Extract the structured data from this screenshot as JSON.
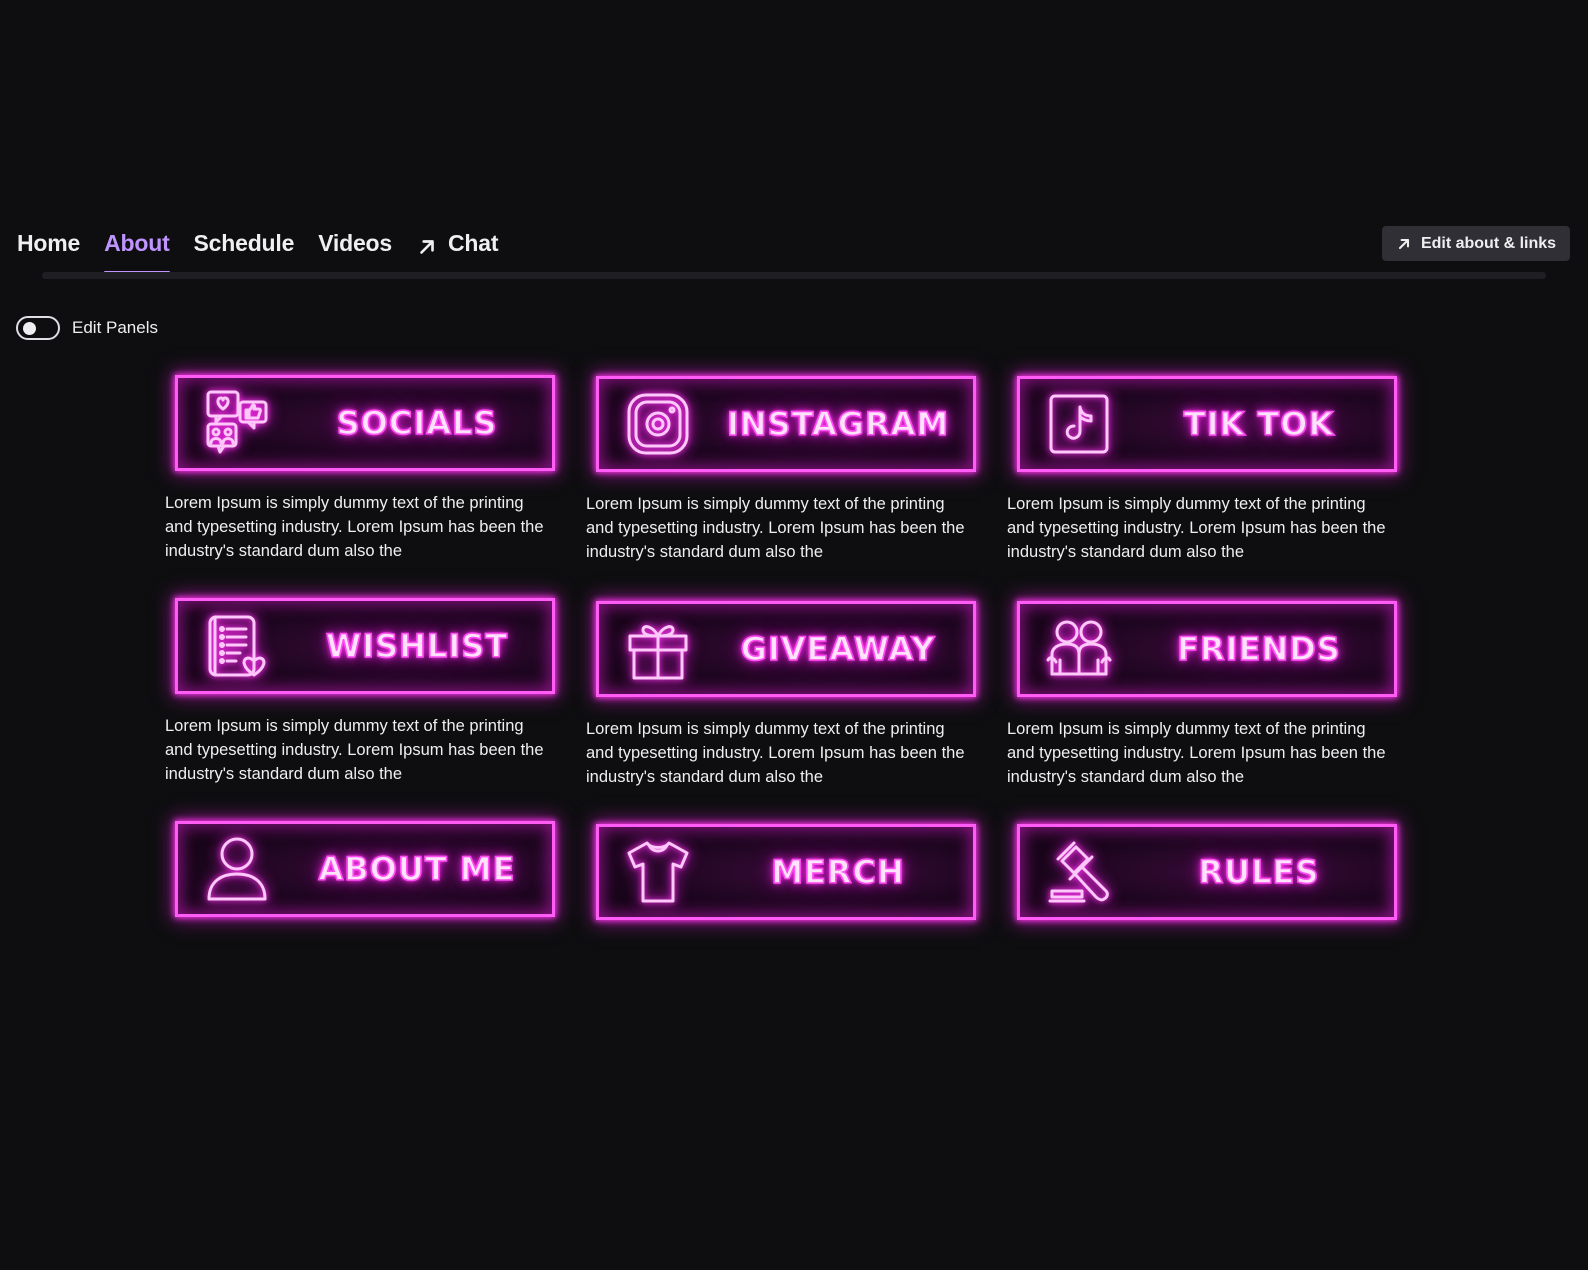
{
  "nav": {
    "tabs": [
      {
        "label": "Home"
      },
      {
        "label": "About"
      },
      {
        "label": "Schedule"
      },
      {
        "label": "Videos"
      },
      {
        "label": "Chat"
      }
    ],
    "active_tab": "About",
    "edit_links_label": "Edit about & links"
  },
  "edit_panels": {
    "label": "Edit Panels",
    "enabled": false
  },
  "panels": [
    {
      "title": "SOCIALS",
      "icon": "social-media-icon",
      "description": "Lorem Ipsum is simply dummy text of the printing and typesetting industry. Lorem Ipsum has been the industry's standard dum also the"
    },
    {
      "title": "INSTAGRAM",
      "icon": "instagram-icon",
      "description": "Lorem Ipsum is simply dummy text of the printing and typesetting industry. Lorem Ipsum has been the industry's standard dum also the"
    },
    {
      "title": "TIK TOK",
      "icon": "tiktok-icon",
      "description": "Lorem Ipsum is simply dummy text of the printing and typesetting industry. Lorem Ipsum has been the industry's standard dum also the"
    },
    {
      "title": "WISHLIST",
      "icon": "wishlist-icon",
      "description": "Lorem Ipsum is simply dummy text of the printing and typesetting industry. Lorem Ipsum has been the industry's standard dum also the"
    },
    {
      "title": "GIVEAWAY",
      "icon": "gift-icon",
      "description": "Lorem Ipsum is simply dummy text of the printing and typesetting industry. Lorem Ipsum has been the industry's standard dum also the"
    },
    {
      "title": "FRIENDS",
      "icon": "friends-icon",
      "description": "Lorem Ipsum is simply dummy text of the printing and typesetting industry. Lorem Ipsum has been the industry's standard dum also the"
    },
    {
      "title": "ABOUT ME",
      "icon": "user-icon",
      "description": ""
    },
    {
      "title": "MERCH",
      "icon": "tshirt-icon",
      "description": ""
    },
    {
      "title": "RULES",
      "icon": "gavel-icon",
      "description": ""
    }
  ],
  "colors": {
    "background": "#0e0e10",
    "accent": "#bf94ff",
    "neon": "#ff5cf6",
    "button_bg": "#2f2f35"
  }
}
